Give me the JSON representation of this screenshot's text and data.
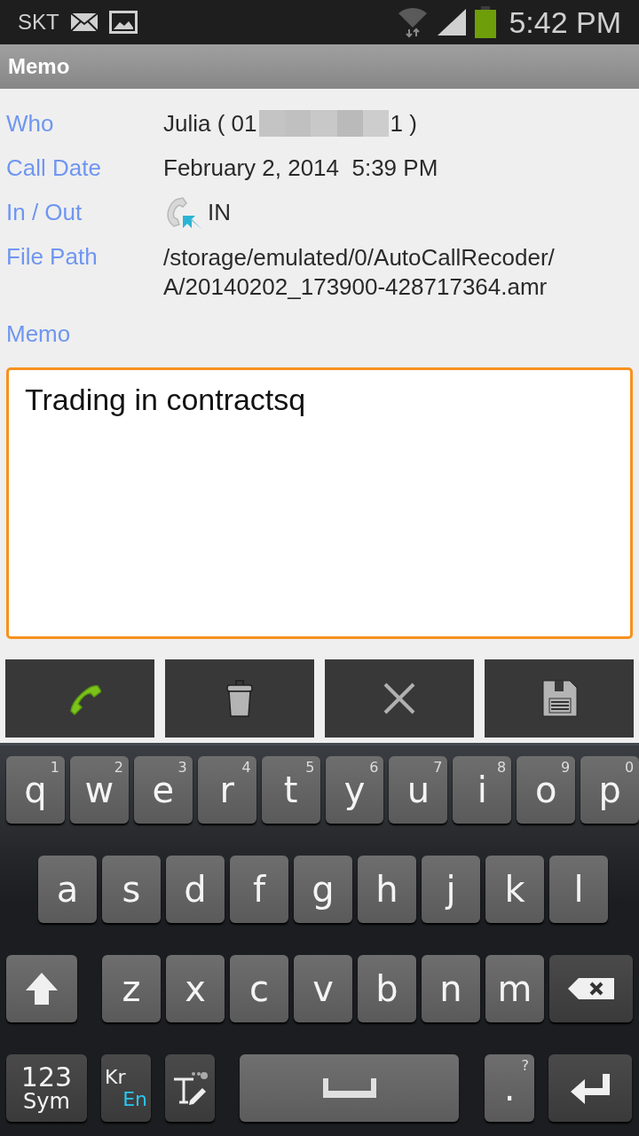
{
  "status_bar": {
    "carrier": "SKT",
    "time": "5:42 PM"
  },
  "title_bar": {
    "title": "Memo"
  },
  "details": {
    "who": {
      "label": "Who",
      "name_prefix": "Julia ( 01",
      "name_suffix": "1 )"
    },
    "call_date": {
      "label": "Call Date",
      "value": "February 2, 2014  5:39 PM"
    },
    "direction": {
      "label": "In / Out",
      "value": "IN"
    },
    "file_path": {
      "label": "File Path",
      "value": "/storage/emulated/0/AutoCallRecoder/ A/20140202_173900-428717364.amr"
    },
    "memo_label": "Memo"
  },
  "memo": {
    "value": "Trading in contractsq"
  },
  "actions": [
    {
      "kind": "call"
    },
    {
      "kind": "delete"
    },
    {
      "kind": "cancel"
    },
    {
      "kind": "save"
    }
  ],
  "keyboard": {
    "rows": [
      {
        "keys": [
          {
            "kind": "letter",
            "label": "q",
            "hint": "1"
          },
          {
            "kind": "letter",
            "label": "w",
            "hint": "2"
          },
          {
            "kind": "letter",
            "label": "e",
            "hint": "3"
          },
          {
            "kind": "letter",
            "label": "r",
            "hint": "4"
          },
          {
            "kind": "letter",
            "label": "t",
            "hint": "5"
          },
          {
            "kind": "letter",
            "label": "y",
            "hint": "6"
          },
          {
            "kind": "letter",
            "label": "u",
            "hint": "7"
          },
          {
            "kind": "letter",
            "label": "i",
            "hint": "8"
          },
          {
            "kind": "letter",
            "label": "o",
            "hint": "9"
          },
          {
            "kind": "letter",
            "label": "p",
            "hint": "0"
          }
        ]
      },
      {
        "keys": [
          {
            "kind": "letter",
            "label": "a"
          },
          {
            "kind": "letter",
            "label": "s"
          },
          {
            "kind": "letter",
            "label": "d"
          },
          {
            "kind": "letter",
            "label": "f"
          },
          {
            "kind": "letter",
            "label": "g"
          },
          {
            "kind": "letter",
            "label": "h"
          },
          {
            "kind": "letter",
            "label": "j"
          },
          {
            "kind": "letter",
            "label": "k"
          },
          {
            "kind": "letter",
            "label": "l"
          }
        ]
      },
      {
        "keys": [
          {
            "kind": "shift"
          },
          {
            "kind": "letter",
            "label": "z"
          },
          {
            "kind": "letter",
            "label": "x"
          },
          {
            "kind": "letter",
            "label": "c"
          },
          {
            "kind": "letter",
            "label": "v"
          },
          {
            "kind": "letter",
            "label": "b"
          },
          {
            "kind": "letter",
            "label": "n"
          },
          {
            "kind": "letter",
            "label": "m"
          },
          {
            "kind": "backspace"
          }
        ]
      },
      {
        "keys": [
          {
            "kind": "mode",
            "label": "123",
            "sub": "Sym"
          },
          {
            "kind": "lang",
            "label": "Kr",
            "sub": "En"
          },
          {
            "kind": "text-tool"
          },
          {
            "kind": "space"
          },
          {
            "kind": "period",
            "label": ".",
            "hint": "?"
          },
          {
            "kind": "enter"
          }
        ]
      }
    ]
  }
}
